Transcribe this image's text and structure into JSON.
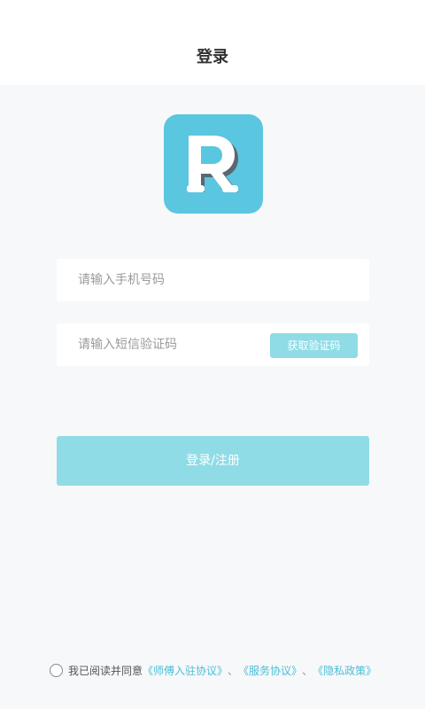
{
  "header": {
    "title": "登录"
  },
  "logo": {
    "letter": "R",
    "color": "#5ac6df"
  },
  "form": {
    "phone_placeholder": "请输入手机号码",
    "code_placeholder": "请输入短信验证码",
    "get_code_label": "获取验证码",
    "submit_label": "登录/注册"
  },
  "agreement": {
    "prefix": "我已阅读并同意",
    "links": [
      "《师傅入驻协议》",
      "《服务协议》",
      "《隐私政策》"
    ],
    "separator": "、",
    "checked": false
  },
  "colors": {
    "accent": "#8fdce6",
    "link": "#4bbfd6",
    "background": "#f7f8fa"
  }
}
